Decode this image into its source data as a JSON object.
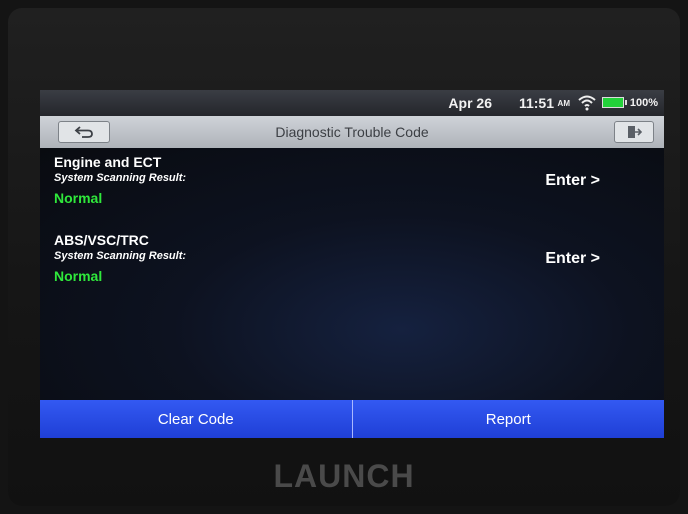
{
  "device": {
    "brand": "LAUNCH"
  },
  "status_bar": {
    "date": "Apr 26",
    "time": "11:51",
    "ampm": "AM",
    "battery": "100%",
    "wifi_icon": "wifi-icon",
    "battery_icon": "battery-icon",
    "battery_color": "#22d23a"
  },
  "header": {
    "title": "Diagnostic Trouble Code",
    "back_icon": "back-arrow-icon",
    "exit_icon": "exit-icon"
  },
  "systems": [
    {
      "name": "Engine and ECT",
      "result_label": "System Scanning Result:",
      "status": "Normal",
      "enter_label": "Enter >"
    },
    {
      "name": "ABS/VSC/TRC",
      "result_label": "System Scanning Result:",
      "status": "Normal",
      "enter_label": "Enter >"
    }
  ],
  "colors": {
    "status_normal": "#2fe83b",
    "action_bar": "#2a4ae8"
  },
  "footer": {
    "clear_label": "Clear Code",
    "report_label": "Report"
  }
}
